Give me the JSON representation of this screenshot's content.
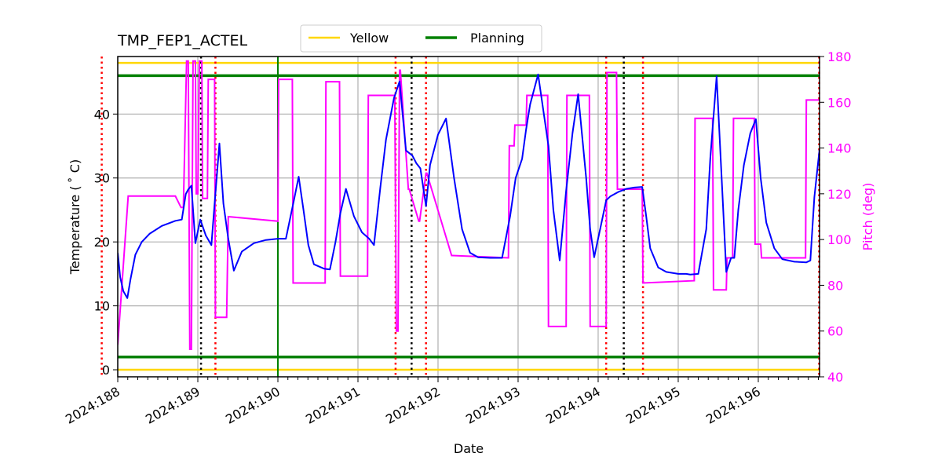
{
  "chart_data": {
    "type": "line",
    "title": "TMP_FEP1_ACTEL",
    "xlabel": "Date",
    "ylabel": "Temperature ($^\\circ$C)",
    "ylabel_display": "Temperature ( ˚ C)",
    "y2label": "Pitch (deg)",
    "xlim": [
      188.0,
      196.765
    ],
    "ylim": [
      -1.1,
      49.0
    ],
    "y2lim": [
      40,
      180
    ],
    "grid": true,
    "legend_position": "top-center",
    "x_ticks": [
      {
        "value": 188,
        "label": "2024:188"
      },
      {
        "value": 189,
        "label": "2024:189"
      },
      {
        "value": 190,
        "label": "2024:190"
      },
      {
        "value": 191,
        "label": "2024:191"
      },
      {
        "value": 192,
        "label": "2024:192"
      },
      {
        "value": 193,
        "label": "2024:193"
      },
      {
        "value": 194,
        "label": "2024:194"
      },
      {
        "value": 195,
        "label": "2024:195"
      },
      {
        "value": 196,
        "label": "2024:196"
      }
    ],
    "y_ticks": [
      0,
      10,
      20,
      30,
      40
    ],
    "y2_ticks": [
      40,
      60,
      80,
      100,
      120,
      140,
      160,
      180
    ],
    "colors": {
      "temperature": "#0000ff",
      "pitch": "#ff00ff",
      "yellow_limit": "#ffd700",
      "planning_limit": "#008000",
      "red_markers": "#ff0000",
      "black_markers": "#000000",
      "grid": "#b0b0b0"
    },
    "legend": [
      {
        "label": "Yellow",
        "color": "#ffd700"
      },
      {
        "label": "Planning",
        "color": "#008000"
      }
    ],
    "limits": [
      {
        "name": "yellow-high",
        "value": 48.0,
        "kind": "Yellow"
      },
      {
        "name": "planning-high",
        "value": 46.0,
        "kind": "Planning"
      },
      {
        "name": "planning-low",
        "value": 2.0,
        "kind": "Planning"
      },
      {
        "name": "yellow-low",
        "value": 0.0,
        "kind": "Yellow"
      }
    ],
    "vertical_markers": [
      {
        "x": 187.8,
        "color": "red",
        "style": "dotted"
      },
      {
        "x": 189.04,
        "color": "black",
        "style": "dotted"
      },
      {
        "x": 189.22,
        "color": "red",
        "style": "dotted"
      },
      {
        "x": 190.0,
        "color": "green",
        "style": "solid"
      },
      {
        "x": 191.47,
        "color": "red",
        "style": "dotted"
      },
      {
        "x": 191.67,
        "color": "black",
        "style": "dotted"
      },
      {
        "x": 191.85,
        "color": "red",
        "style": "dotted"
      },
      {
        "x": 194.1,
        "color": "red",
        "style": "dotted"
      },
      {
        "x": 194.32,
        "color": "black",
        "style": "dotted"
      },
      {
        "x": 194.56,
        "color": "red",
        "style": "dotted"
      },
      {
        "x": 196.76,
        "color": "red",
        "style": "dotted"
      }
    ],
    "series": [
      {
        "name": "TMP_FEP1_ACTEL",
        "axis": "left",
        "x": [
          188.0,
          188.03,
          188.07,
          188.12,
          188.16,
          188.22,
          188.3,
          188.4,
          188.55,
          188.72,
          188.8,
          188.85,
          188.88,
          188.92,
          188.97,
          189.03,
          189.1,
          189.17,
          189.21,
          189.27,
          189.32,
          189.38,
          189.45,
          189.55,
          189.7,
          189.85,
          190.0,
          190.1,
          190.2,
          190.26,
          190.32,
          190.38,
          190.45,
          190.58,
          190.65,
          190.72,
          190.78,
          190.85,
          190.95,
          191.05,
          191.14,
          191.2,
          191.28,
          191.35,
          191.45,
          191.52,
          191.6,
          191.68,
          191.73,
          191.78,
          191.85,
          191.9,
          192.0,
          192.1,
          192.2,
          192.3,
          192.4,
          192.5,
          192.65,
          192.8,
          192.9,
          192.97,
          193.05,
          193.1,
          193.15,
          193.25,
          193.38,
          193.44,
          193.52,
          193.6,
          193.68,
          193.75,
          193.85,
          193.9,
          193.95,
          194.05,
          194.1,
          194.15,
          194.25,
          194.35,
          194.45,
          194.55,
          194.6,
          194.65,
          194.75,
          194.85,
          195.0,
          195.1,
          195.15,
          195.25,
          195.35,
          195.4,
          195.48,
          195.55,
          195.6,
          195.66,
          195.7,
          195.75,
          195.82,
          195.9,
          195.97,
          196.03,
          196.1,
          196.2,
          196.3,
          196.45,
          196.6,
          196.65,
          196.7,
          196.765
        ],
        "y": [
          18.3,
          14.5,
          12.3,
          11.2,
          14.2,
          18.0,
          20.0,
          21.3,
          22.5,
          23.3,
          23.5,
          27.5,
          28.2,
          28.8,
          19.8,
          23.5,
          21.0,
          19.5,
          26.0,
          35.4,
          26.0,
          20.5,
          15.5,
          18.5,
          19.8,
          20.3,
          20.5,
          20.5,
          26.5,
          30.2,
          25.0,
          19.5,
          16.5,
          15.8,
          15.7,
          20.0,
          24.5,
          28.3,
          24.0,
          21.5,
          20.5,
          19.5,
          28.5,
          36.0,
          42.5,
          45.1,
          34.3,
          33.5,
          32.3,
          31.5,
          25.6,
          32.0,
          36.8,
          39.3,
          30.0,
          22.0,
          18.3,
          17.6,
          17.5,
          17.5,
          24.0,
          30.0,
          33.0,
          37.6,
          41.5,
          46.2,
          35.0,
          25.0,
          17.1,
          28.0,
          37.0,
          43.1,
          30.0,
          22.0,
          17.6,
          23.5,
          26.5,
          27.1,
          27.8,
          28.3,
          28.5,
          28.6,
          24.0,
          19.0,
          16.0,
          15.3,
          15.0,
          15.0,
          14.9,
          15.0,
          22.0,
          33.0,
          45.9,
          28.0,
          15.3,
          17.5,
          17.5,
          25.0,
          32.0,
          37.0,
          39.2,
          30.0,
          23.0,
          19.0,
          17.3,
          16.9,
          16.8,
          17.1,
          27.0,
          34.5
        ]
      },
      {
        "name": "Pitch",
        "axis": "right",
        "step": true,
        "x": [
          188.0,
          188.13,
          188.72,
          188.79,
          188.82,
          188.86,
          188.88,
          188.9,
          188.92,
          188.94,
          188.97,
          188.98,
          189.0,
          189.02,
          189.05,
          189.06,
          189.12,
          189.13,
          189.21,
          189.22,
          189.36,
          189.38,
          190.0,
          190.01,
          190.18,
          190.19,
          190.59,
          190.6,
          190.77,
          190.78,
          191.12,
          191.13,
          191.46,
          191.48,
          191.5,
          191.52,
          191.53,
          191.63,
          191.64,
          191.76,
          191.77,
          191.85,
          191.86,
          192.17,
          192.18,
          192.88,
          192.89,
          192.95,
          192.96,
          193.1,
          193.11,
          193.37,
          193.38,
          193.6,
          193.61,
          193.89,
          193.9,
          194.1,
          194.11,
          194.23,
          194.24,
          194.55,
          194.56,
          195.2,
          195.21,
          195.43,
          195.44,
          195.6,
          195.61,
          195.68,
          195.69,
          195.95,
          195.96,
          196.03,
          196.04,
          196.59,
          196.6,
          196.765
        ],
        "y": [
          54,
          119,
          119,
          114,
          114,
          178,
          178,
          52,
          52,
          178,
          178,
          120,
          120,
          178,
          178,
          118,
          118,
          170,
          170,
          66,
          66,
          110,
          108,
          170,
          170,
          81,
          81,
          169,
          169,
          84,
          84,
          163,
          163,
          60,
          60,
          174,
          174,
          122,
          122,
          108,
          108,
          129,
          129,
          93,
          93,
          92,
          141,
          141,
          150,
          150,
          163,
          163,
          62,
          62,
          163,
          163,
          62,
          62,
          173,
          173,
          122,
          122,
          81,
          82,
          153,
          153,
          78,
          78,
          92,
          92,
          153,
          153,
          98,
          98,
          92,
          92,
          161,
          161
        ]
      }
    ]
  }
}
